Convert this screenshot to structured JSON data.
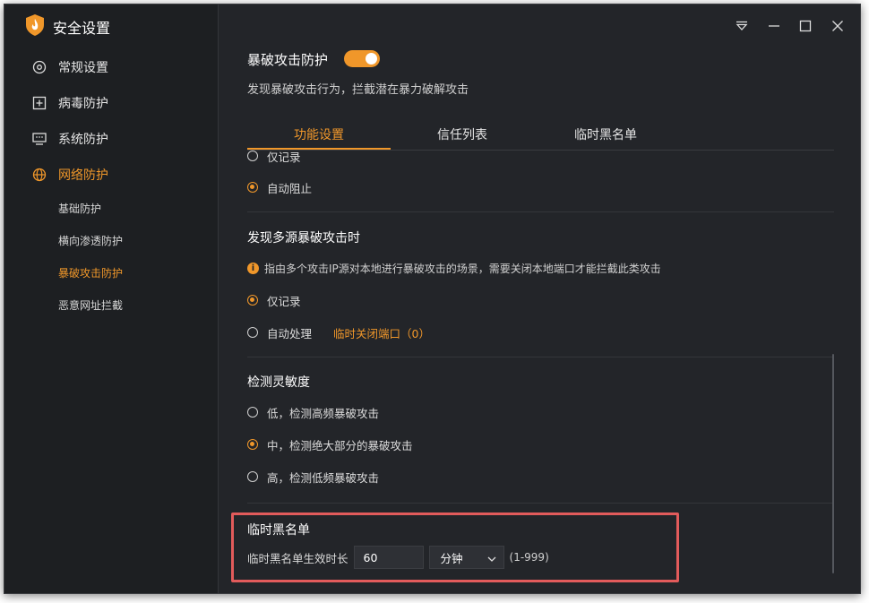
{
  "app": {
    "title": "安全设置"
  },
  "sidebar": {
    "items": [
      {
        "label": "常规设置"
      },
      {
        "label": "病毒防护"
      },
      {
        "label": "系统防护"
      },
      {
        "label": "网络防护"
      }
    ],
    "subitems": [
      {
        "label": "基础防护"
      },
      {
        "label": "横向渗透防护"
      },
      {
        "label": "暴破攻击防护"
      },
      {
        "label": "恶意网址拦截"
      }
    ]
  },
  "header": {
    "title": "暴破攻击防护",
    "toggle_on": true,
    "description": "发现暴破攻击行为，拦截潜在暴力破解攻击"
  },
  "tabs": [
    {
      "label": "功能设置"
    },
    {
      "label": "信任列表"
    },
    {
      "label": "临时黑名单"
    }
  ],
  "content": {
    "section1": {
      "partial_option": "仅记录",
      "option_auto_block": "自动阻止"
    },
    "section2": {
      "title": "发现多源暴破攻击时",
      "info": "指由多个攻击IP源对本地进行暴破攻击的场景，需要关闭本地端口才能拦截此类攻击",
      "option_record": "仅记录",
      "option_auto": "自动处理",
      "link": "临时关闭端口（0）"
    },
    "section3": {
      "title": "检测灵敏度",
      "low": "低，检测高频暴破攻击",
      "mid": "中，检测绝大部分的暴破攻击",
      "high": "高，检测低频暴破攻击"
    },
    "section4": {
      "title": "临时黑名单",
      "field_label": "临时黑名单生效时长",
      "value": "60",
      "unit": "分钟",
      "range": "(1-999)"
    }
  },
  "colors": {
    "accent": "#f0972a",
    "highlight": "#e25b5b",
    "background": "#232529"
  }
}
